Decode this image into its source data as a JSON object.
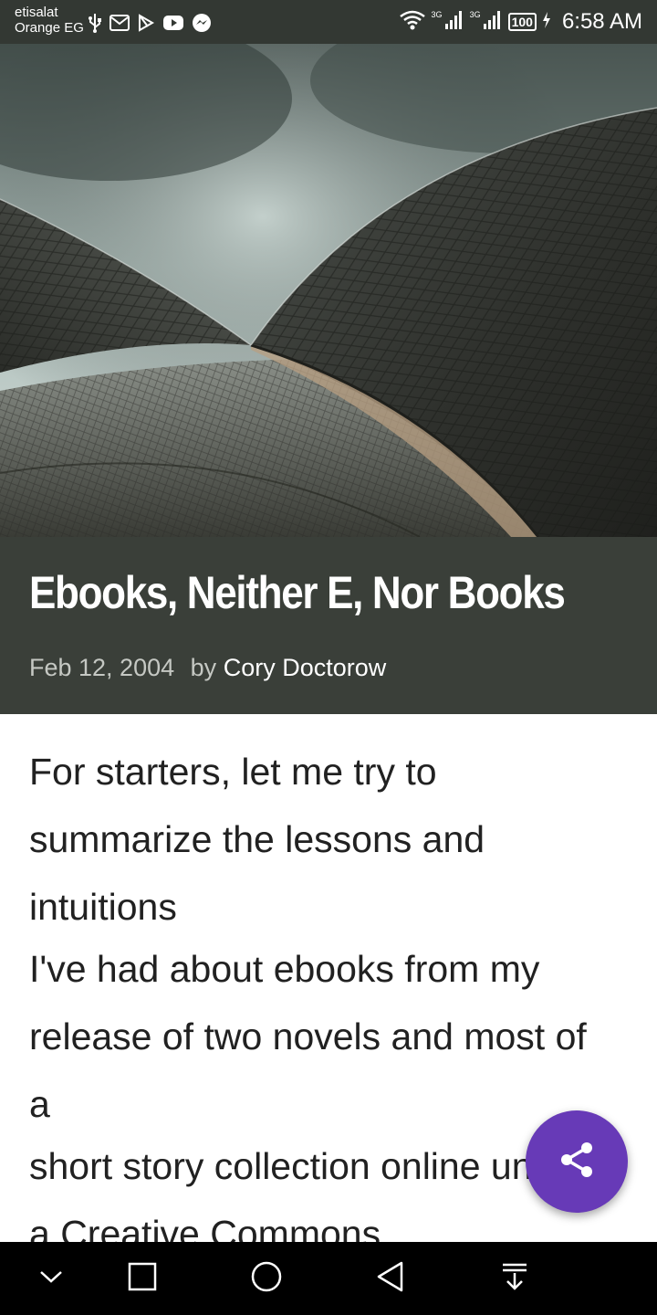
{
  "status_bar": {
    "carrier_line1": "etisalat",
    "carrier_line2": "Orange EG",
    "notification_icons": [
      "usb-icon",
      "gmail-icon",
      "play-store-icon",
      "youtube-icon",
      "messenger-icon"
    ],
    "network1": "3G",
    "network2": "3G",
    "battery": "100",
    "time": "6:58 AM"
  },
  "hero": {
    "image_icon": "opera-house-roof-image"
  },
  "post": {
    "title": "Ebooks, Neither E, Nor Books",
    "date": "Feb 12, 2004",
    "by_label": "by",
    "author": "Cory Doctorow"
  },
  "article": {
    "paragraphs": [
      "For starters, let me try to summarize the lessons and intuitions",
      "I've had about ebooks from my release of two novels and most of a",
      "short story collection online under a Creative Commons"
    ]
  },
  "fab": {
    "icon": "share-icon",
    "color": "#673ab7"
  },
  "nav_bar": {
    "buttons": [
      "hide-icon",
      "recents-icon",
      "home-icon",
      "back-icon",
      "notifications-pull-icon"
    ]
  },
  "colors": {
    "status_bar": "#333833",
    "title_block": "#3a3f39",
    "article_text": "#212121"
  }
}
